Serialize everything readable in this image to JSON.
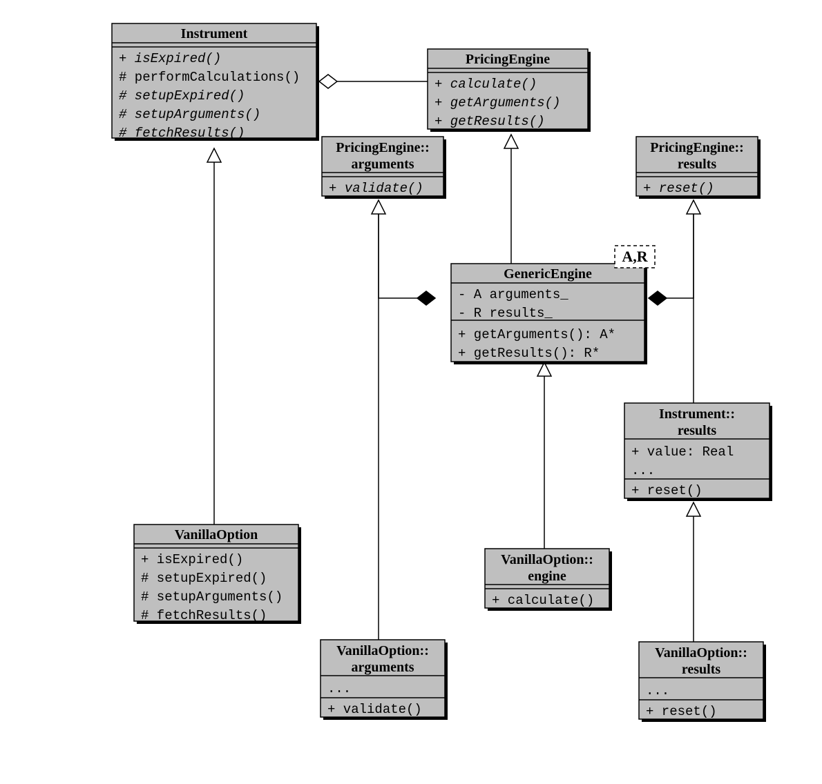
{
  "classes": {
    "Instrument": {
      "name": "Instrument",
      "members": [
        {
          "t": "+ isExpired()",
          "i": true
        },
        {
          "t": "# performCalculations()",
          "i": false
        },
        {
          "t": "# setupExpired()",
          "i": true
        },
        {
          "t": "# setupArguments()",
          "i": true
        },
        {
          "t": "# fetchResults()",
          "i": true
        }
      ]
    },
    "PricingEngine": {
      "name": "PricingEngine",
      "members": [
        {
          "t": "+ calculate()",
          "i": true
        },
        {
          "t": "+ getArguments()",
          "i": true
        },
        {
          "t": "+ getResults()",
          "i": true
        }
      ]
    },
    "PEarguments": {
      "name_lines": [
        "PricingEngine::",
        "arguments"
      ],
      "members": [
        {
          "t": "+ validate()",
          "i": true
        }
      ]
    },
    "PEresults": {
      "name_lines": [
        "PricingEngine::",
        "results"
      ],
      "members": [
        {
          "t": "+ reset()",
          "i": true
        }
      ]
    },
    "GenericEngine": {
      "name": "GenericEngine",
      "template": "A,R",
      "attrs": [
        {
          "t": "- A arguments_",
          "i": false
        },
        {
          "t": "- R results_",
          "i": false
        }
      ],
      "methods": [
        {
          "t": "+ getArguments(): A*",
          "i": false
        },
        {
          "t": "+ getResults(): R*",
          "i": false
        }
      ]
    },
    "InstrResults": {
      "name_lines": [
        "Instrument::",
        "results"
      ],
      "attrs": [
        {
          "t": "+ value:  Real",
          "i": false
        },
        {
          "t": "...",
          "i": false
        }
      ],
      "methods": [
        {
          "t": "+ reset()",
          "i": false
        }
      ]
    },
    "VanillaOption": {
      "name": "VanillaOption",
      "members": [
        {
          "t": "+ isExpired()",
          "i": false
        },
        {
          "t": "# setupExpired()",
          "i": false
        },
        {
          "t": "# setupArguments()",
          "i": false
        },
        {
          "t": "# fetchResults()",
          "i": false
        }
      ]
    },
    "VOengine": {
      "name_lines": [
        "VanillaOption::",
        "engine"
      ],
      "members": [
        {
          "t": "+ calculate()",
          "i": false
        }
      ]
    },
    "VOarguments": {
      "name_lines": [
        "VanillaOption::",
        "arguments"
      ],
      "attrs": [
        {
          "t": "...",
          "i": false
        }
      ],
      "methods": [
        {
          "t": "+ validate()",
          "i": false
        }
      ]
    },
    "VOresults": {
      "name_lines": [
        "VanillaOption::",
        "results"
      ],
      "attrs": [
        {
          "t": "...",
          "i": false
        }
      ],
      "methods": [
        {
          "t": "+ reset()",
          "i": false
        }
      ]
    }
  }
}
